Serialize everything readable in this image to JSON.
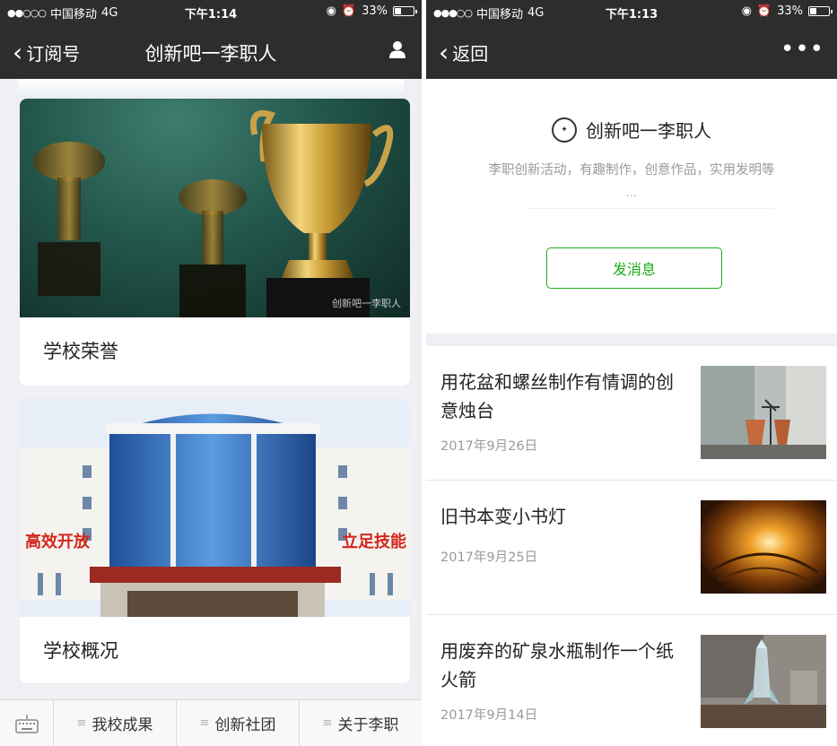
{
  "left_screen": {
    "status": {
      "carrier": "中国移动",
      "network": "4G",
      "time": "下午1:14",
      "battery": "33%",
      "battery_level": 0.33
    },
    "nav": {
      "back_label": "订阅号",
      "title": "创新吧一李职人"
    },
    "cards": [
      {
        "label": "学校荣誉",
        "watermark": "创新吧一李职人",
        "image": "trophy-photo"
      },
      {
        "label": "学校概况",
        "image": "building-photo",
        "left_banner": "高效开放",
        "right_banner": "立足技能"
      }
    ],
    "menu": [
      {
        "label": "我校成果"
      },
      {
        "label": "创新社团"
      },
      {
        "label": "关于李职"
      }
    ]
  },
  "right_screen": {
    "status": {
      "carrier": "中国移动",
      "network": "4G",
      "time": "下午1:13",
      "battery": "33%",
      "battery_level": 0.33
    },
    "nav": {
      "back_label": "返回",
      "more": "•••"
    },
    "profile": {
      "name": "创新吧一李职人",
      "description": "李职创新活动，有趣制作，创意作品，实用发明等",
      "ellipsis": "...",
      "send_button": "发消息"
    },
    "articles": [
      {
        "title": "用花盆和螺丝制作有情调的创意烛台",
        "date": "2017年9月26日"
      },
      {
        "title": "旧书本变小书灯",
        "date": "2017年9月25日"
      },
      {
        "title": "用废弃的矿泉水瓶制作一个纸火箭",
        "date": "2017年9月14日"
      }
    ]
  },
  "colors": {
    "nav_bg": "#2d2d2d",
    "accent_green": "#1aad19",
    "page_bg": "#efeff4"
  }
}
